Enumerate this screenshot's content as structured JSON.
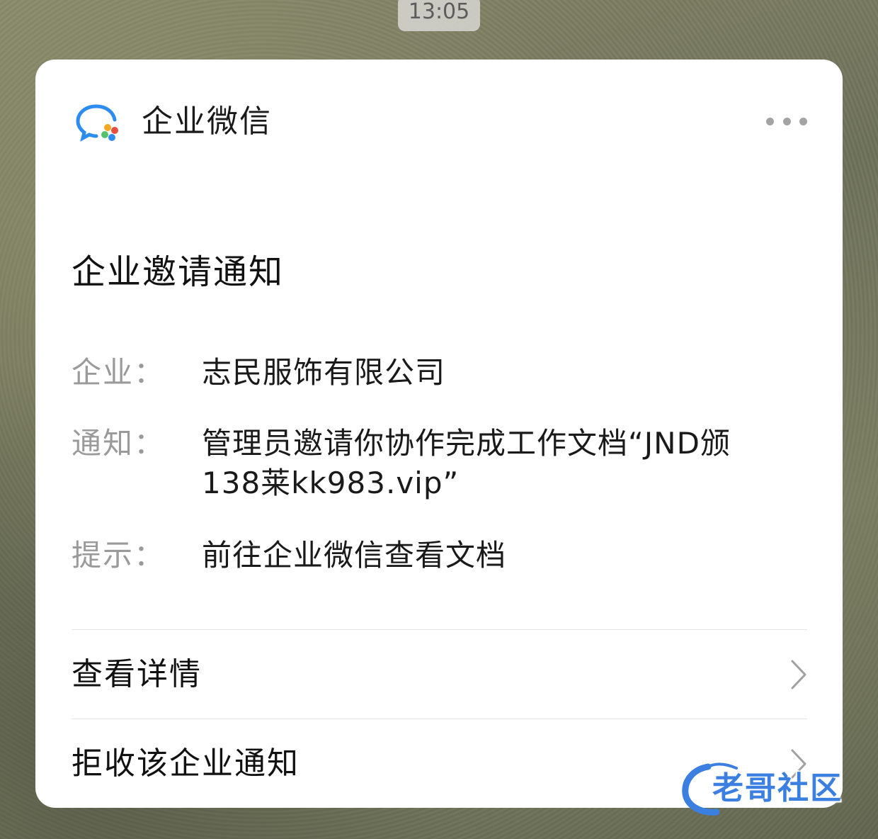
{
  "status_bar": {
    "time": "13:05"
  },
  "header": {
    "app_name": "企业微信",
    "app_icon": "wecom-chat-icon",
    "more_icon": "more-dots-icon"
  },
  "notice": {
    "title": "企业邀请通知",
    "fields": [
      {
        "label": "企业：",
        "value": "志民服饰有限公司"
      },
      {
        "label": "通知：",
        "value": "管理员邀请你协作完成工作文档“JND颁138莱kk983.vip”"
      },
      {
        "label": "提示：",
        "value": "前往企业微信查看文档"
      }
    ]
  },
  "actions": [
    {
      "label": "查看详情",
      "icon": "chevron-right-icon"
    },
    {
      "label": "拒收该企业通知",
      "icon": "chevron-right-icon"
    }
  ],
  "watermark": {
    "text": "老哥社区"
  },
  "colors": {
    "card_bg": "#ffffff",
    "label_gray": "#9a9a9a",
    "text_dark": "#1a1a1a",
    "divider": "#e4e4e4",
    "wecom_blue": "#2d8cf0"
  }
}
